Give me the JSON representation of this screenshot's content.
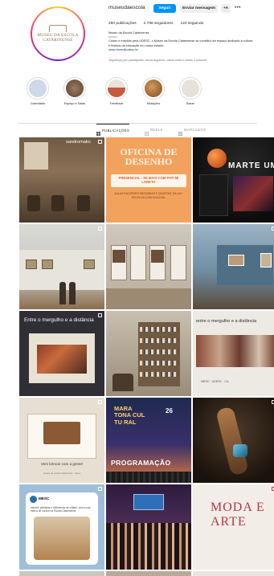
{
  "profile": {
    "avatar_lines": [
      "MUSEU DA ESCOLA",
      "CATARINENSE"
    ],
    "username": "museudaescola",
    "follow_label": "Seguir",
    "message_label": "Enviar mensagem",
    "suggest_label": "+A",
    "more_label": "•••",
    "stats": {
      "posts": "260 publicações",
      "followers": "2.796 seguidores",
      "following": "120 seguindo"
    },
    "bio": {
      "name": "Museu da Escola Catarinense",
      "category": "Museu",
      "text": "Criado e mantido pela UDESC, o Museu da Escola Catarinense se constitui um espaço dedicado à cultura e história da educação em nosso estado.",
      "link": "mesc.fcme@udesc.br"
    },
    "followed_by": "Seguido(a) por joanafpoeta, leticia.seguinho, udesc.ceart e outras 4 pessoas"
  },
  "highlights": [
    {
      "label": "Calendário",
      "color": "#cfd8e6"
    },
    {
      "label": "Espaço e Salas",
      "color": "#7a5a44"
    },
    {
      "label": "Feedback",
      "color": "#c45b3f"
    },
    {
      "label": "Mutações",
      "color": "#b8763a"
    },
    {
      "label": "Bazar",
      "color": "#e5e2da"
    }
  ],
  "tabs": [
    {
      "label": "PUBLICAÇÕES",
      "active": true
    },
    {
      "label": "REELS",
      "active": false
    },
    {
      "label": "MARCADOS",
      "active": false
    }
  ],
  "posts": {
    "p1_tag": "sandromako",
    "p2_title": "OFICINA DE DESENHO",
    "p2_band": "PRESENCIAL - SE MAIS COM PATI MI LORETO",
    "p2_small": "AULAS EM GRUPO SEGUNDAS E QUARTAS, DA 14H. ESCOLHA COM 15 AULAS.",
    "p3_title": "MARTE UM",
    "p7_title": "Entre o mergulho e a distância",
    "p9_title": "entre o mergulho e a distância",
    "p9_logos": "MESC  ·  UDESC  ·  CA",
    "p10_caption": "Vem brincar com a gente!",
    "p10_sub": "museu da escola catarinense · udesc",
    "p11_title": "MARA TONA CUL TU RAL",
    "p11_date": "26",
    "p11_prog": "PROGRAMAÇÃO",
    "p13_handle": "MESC",
    "p13_text": "Informe palestras e bibliotecas de cidade, com a sua marca de cursos na Escola Catarinense",
    "p15_title": "MODA E ARTE"
  }
}
